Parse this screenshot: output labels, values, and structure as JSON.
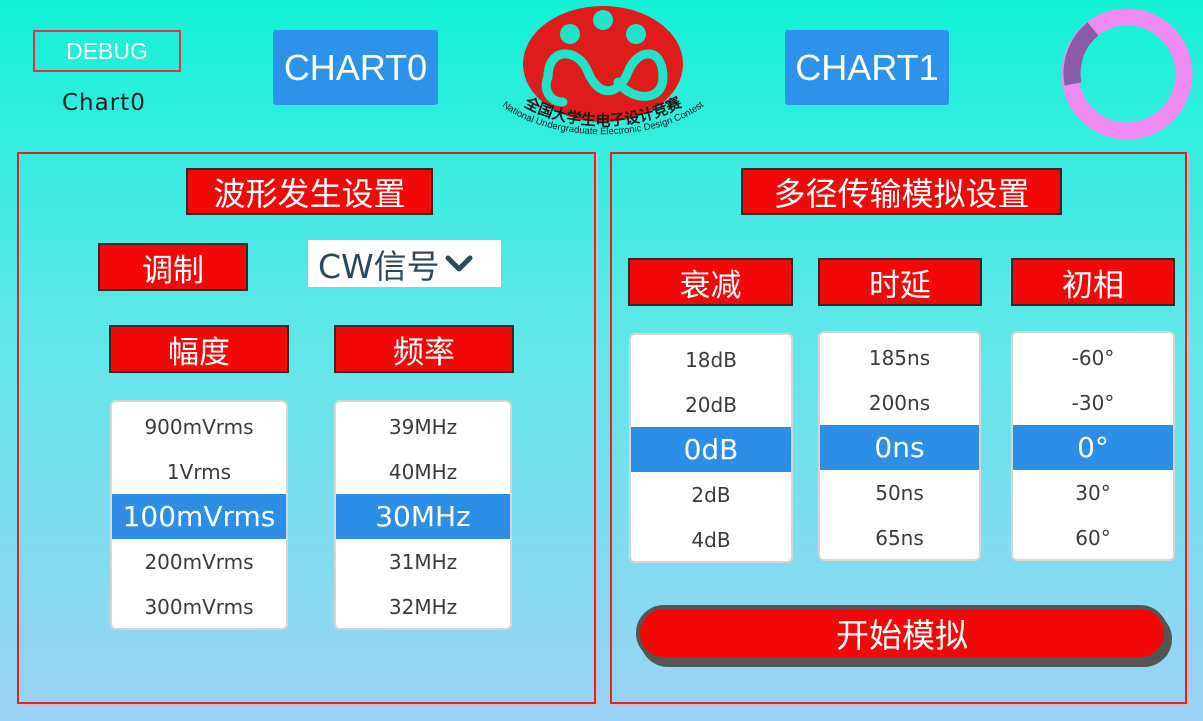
{
  "header": {
    "debug_label": "DEBUG",
    "chart_label": "Chart0",
    "chart0_button": "CHART0",
    "chart1_button": "CHART1",
    "logo": {
      "text_cn": "全国大学生电子设计竞赛",
      "text_en": "National Undergraduate Electronic Design Contest"
    },
    "spinner_color": "#f08af0"
  },
  "waveform": {
    "title": "波形发生设置",
    "modulation_label": "调制",
    "modulation_value": "CW信号",
    "amplitude_label": "幅度",
    "frequency_label": "频率",
    "amplitude_options": [
      "900mVrms",
      "1Vrms",
      "100mVrms",
      "200mVrms",
      "300mVrms"
    ],
    "frequency_options": [
      "39MHz",
      "40MHz",
      "30MHz",
      "31MHz",
      "32MHz"
    ]
  },
  "multipath": {
    "title": "多径传输模拟设置",
    "attenuation_label": "衰减",
    "delay_label": "时延",
    "phase_label": "初相",
    "attenuation_options": [
      "18dB",
      "20dB",
      "0dB",
      "2dB",
      "4dB"
    ],
    "delay_options": [
      "185ns",
      "200ns",
      "0ns",
      "50ns",
      "65ns"
    ],
    "phase_options": [
      "-60°",
      "-30°",
      "0°",
      "30°",
      "60°"
    ],
    "start_button": "开始模拟"
  }
}
